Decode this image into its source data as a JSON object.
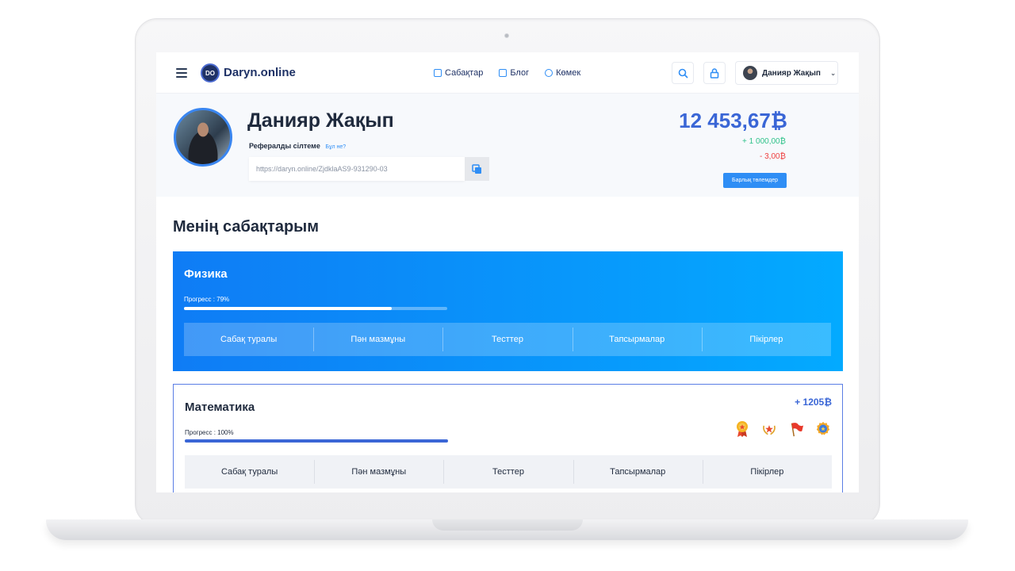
{
  "header": {
    "logo_initials": "DO",
    "logo_text": "Daryn.online",
    "nav": [
      "Сабақтар",
      "Блог",
      "Көмек"
    ],
    "user_name": "Данияр Жақып"
  },
  "profile": {
    "name": "Данияр Жақып",
    "referral_label": "Рефералды сілтеме",
    "referral_help": "Бұл не?",
    "referral_link": "https://daryn.online/ZjdklaAS9-931290-03",
    "balance": "12 453,67₿",
    "income": "+ 1 000,00₿",
    "expense": "- 3,00₿",
    "payments_button": "Барлық төлемдер"
  },
  "section_title": "Менің сабақтарым",
  "courses": [
    {
      "name": "Физика",
      "progress_label": "Прогресс : 79%",
      "progress": 0.79,
      "tabs": [
        "Сабақ туралы",
        "Пән мазмұны",
        "Тесттер",
        "Тапсырмалар",
        "Пікірлер"
      ]
    },
    {
      "name": "Математика",
      "progress_label": "Прогресс : 100%",
      "progress": 1.0,
      "bonus": "+ 1205₿",
      "badges": [
        "medal-icon",
        "laurel-star-icon",
        "flag-icon",
        "award-icon"
      ],
      "tabs": [
        "Сабақ туралы",
        "Пән мазмұны",
        "Тесттер",
        "Тапсырмалар",
        "Пікірлер"
      ]
    }
  ],
  "colors": {
    "accent": "#2f8ef5",
    "brand": "#1f3266",
    "balance": "#3a66d6",
    "income": "#2fc28a",
    "expense": "#ee4040"
  }
}
